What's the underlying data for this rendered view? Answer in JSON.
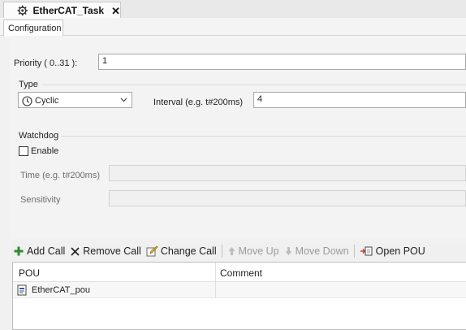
{
  "document_tab": {
    "title": "EtherCAT_Task",
    "close_glyph": "✕"
  },
  "sub_tabs": [
    {
      "label": "Configuration"
    }
  ],
  "priority": {
    "label": "Priority ( 0..31  ):",
    "value": "1"
  },
  "type_section": {
    "heading": "Type",
    "selected": "Cyclic",
    "icon": "clock-icon",
    "interval_label": "Interval (e.g. t#200ms)",
    "interval_value": "4"
  },
  "watchdog": {
    "heading": "Watchdog",
    "enable_label": "Enable",
    "enabled": false,
    "time_label": "Time (e.g. t#200ms)",
    "time_value": "",
    "sensitivity_label": "Sensitivity",
    "sensitivity_value": ""
  },
  "toolbar": {
    "add_call": "Add Call",
    "remove_call": "Remove Call",
    "change_call": "Change Call",
    "move_up": "Move Up",
    "move_down": "Move Down",
    "open_pou": "Open POU"
  },
  "calls_table": {
    "columns": [
      "POU",
      "Comment"
    ],
    "rows": [
      {
        "pou": "EtherCAT_pou",
        "comment": ""
      }
    ]
  },
  "colors": {
    "accent_green": "#2e8b2e",
    "icon_blue": "#2a5db0",
    "disabled_text": "#9a9a9a"
  }
}
